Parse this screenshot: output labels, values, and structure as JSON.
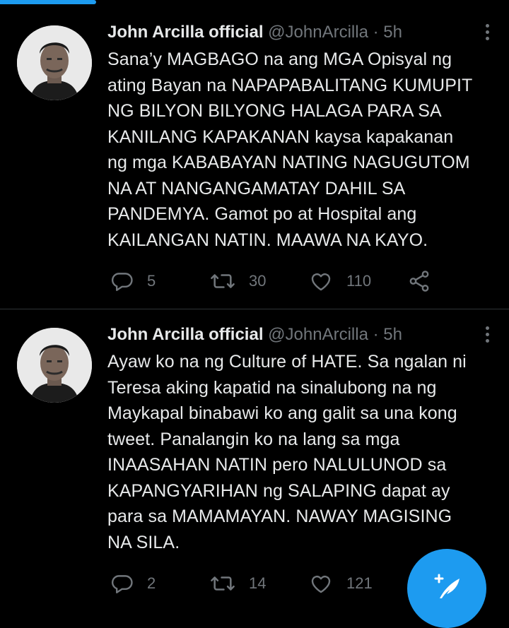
{
  "tweets": [
    {
      "author_name": "John Arcilla official",
      "handle": "@JohnArcilla",
      "separator": "·",
      "time": "5h",
      "avatar_icon": "profile-photo",
      "text_lines": [
        "Sana’y MAGBAGO na ang MGA Opisyal ng",
        "ating Bayan na NAPAPABALITANG KUMUPIT",
        "NG BILYON BILYONG HALAGA PARA SA",
        "KANILANG KAPAKANAN kaysa kapakanan",
        "ng mga KABABAYAN NATING NAGUGUTOM",
        "NA AT  NANGANGAMATAY DAHIL SA",
        "PANDEMYA. Gamot po at Hospital ang",
        "KAILANGAN NATIN. MAAWA NA KAYO."
      ],
      "replies": "5",
      "retweets": "30",
      "likes": "110"
    },
    {
      "author_name": "John Arcilla official",
      "handle": "@JohnArcilla",
      "separator": "·",
      "time": "5h",
      "avatar_icon": "profile-photo",
      "text_lines": [
        "Ayaw ko na ng Culture of HATE. Sa ngalan ni",
        "Teresa aking kapatid na sinalubong na ng",
        "Maykapal binabawi ko ang galit sa una kong",
        "tweet. Panalangin ko na lang sa mga",
        "INAASAHAN NATIN pero NALULUNOD sa",
        "KAPANGYARIHAN ng SALAPING dapat ay",
        "para sa MAMAMAYAN. NAWAY MAGISING",
        "NA SILA."
      ],
      "replies": "2",
      "retweets": "14",
      "likes": "121"
    }
  ],
  "icons": {
    "reply": "reply-icon",
    "retweet": "retweet-icon",
    "like": "heart-icon",
    "share": "share-icon",
    "more": "more-vertical-icon",
    "compose": "compose-feather-icon"
  },
  "colors": {
    "background": "#000000",
    "text_primary": "#e7e9ea",
    "text_secondary": "#71767b",
    "accent": "#1d9bf0",
    "divider": "#2f3336"
  }
}
